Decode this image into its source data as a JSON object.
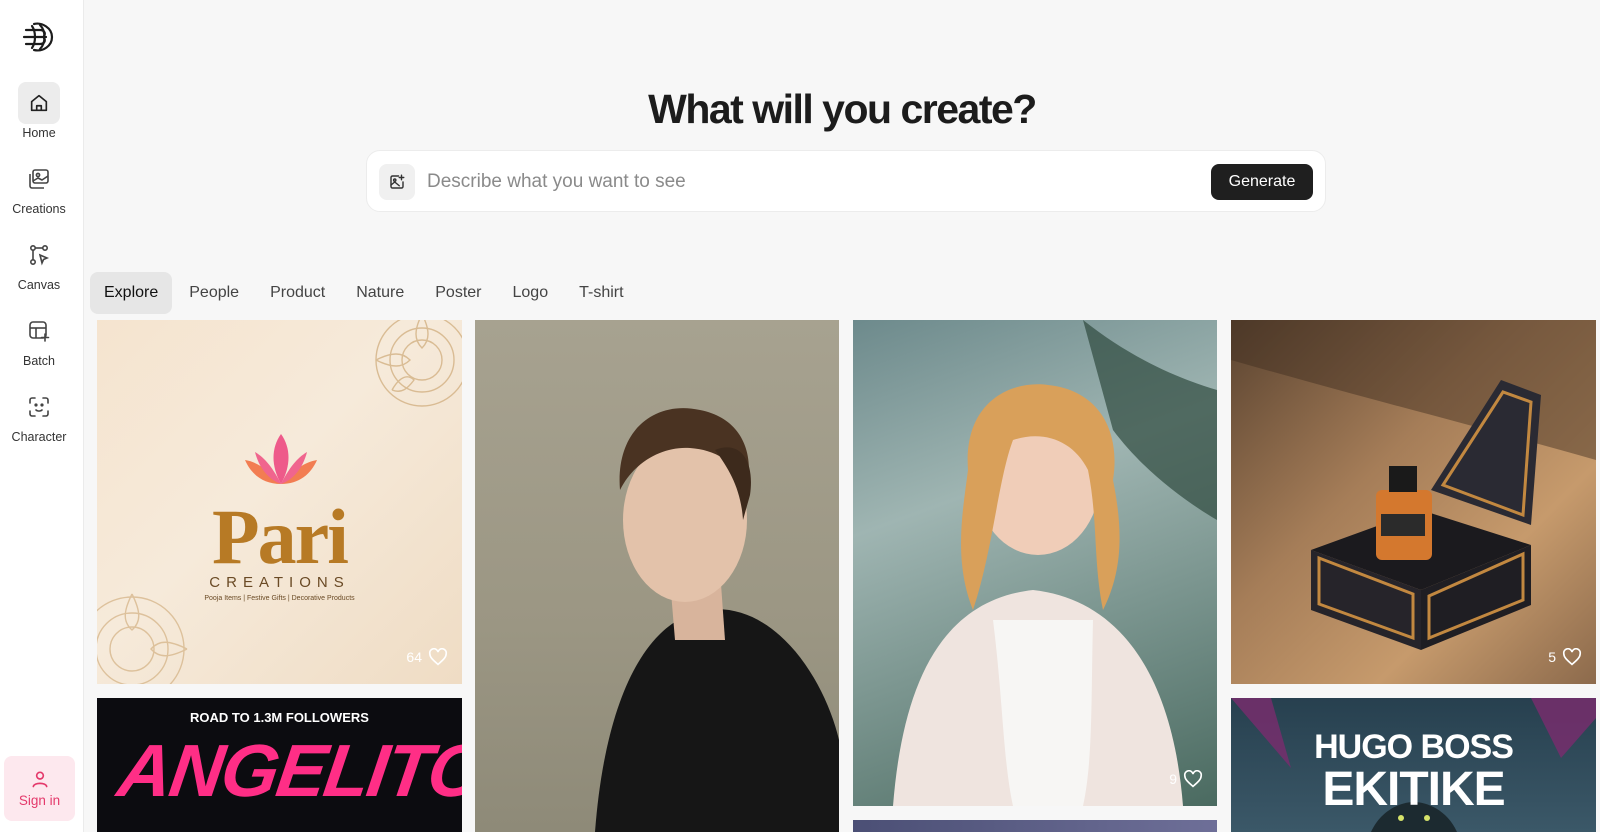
{
  "sidebar": {
    "items": [
      {
        "label": "Home",
        "icon": "home-icon",
        "active": true
      },
      {
        "label": "Creations",
        "icon": "images-icon",
        "active": false
      },
      {
        "label": "Canvas",
        "icon": "canvas-icon",
        "active": false
      },
      {
        "label": "Batch",
        "icon": "batch-icon",
        "active": false
      },
      {
        "label": "Character",
        "icon": "character-scan-icon",
        "active": false
      }
    ],
    "sign_in": "Sign in"
  },
  "hero": {
    "title": "What will you create?",
    "placeholder": "Describe what you want to see",
    "generate": "Generate"
  },
  "tabs": [
    "Explore",
    "People",
    "Product",
    "Nature",
    "Poster",
    "Logo",
    "T-shirt"
  ],
  "active_tab": "Explore",
  "gallery": {
    "c1": {
      "likes": "64",
      "brand": "Pari",
      "sub": "CREATIONS",
      "tagline": "Pooja Items | Festive Gifts | Decorative Products"
    },
    "c3": {
      "likes": "9"
    },
    "c4": {
      "likes": "5"
    },
    "c5": {
      "headline": "ROAD TO 1.3M FOLLOWERS",
      "name": "ANGELITO"
    },
    "c7": {
      "line1": "HUGO BOSS",
      "line2": "EKITIKE"
    }
  },
  "colors": {
    "accent_signin": "#e4396b",
    "generate_bg": "#1f1f1f"
  }
}
